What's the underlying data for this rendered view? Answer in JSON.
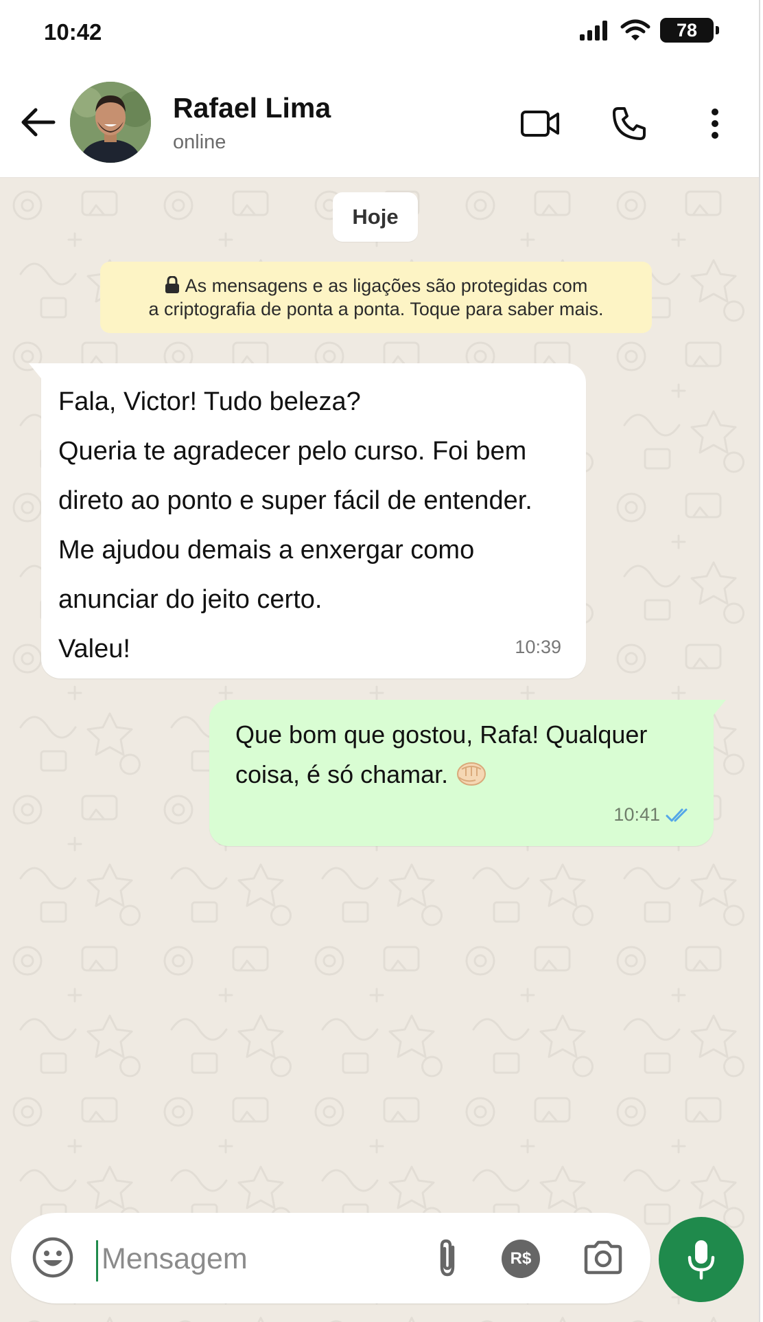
{
  "status_bar": {
    "time": "10:42",
    "battery_level": "78",
    "icons": [
      "signal-icon",
      "wifi-icon",
      "battery-icon"
    ]
  },
  "header": {
    "contact_name": "Rafael Lima",
    "contact_status": "online",
    "icons": [
      "back-arrow-icon",
      "video-call-icon",
      "phone-call-icon",
      "more-options-icon"
    ]
  },
  "chat": {
    "date_separator": "Hoje",
    "encryption_notice": {
      "line1": "As mensagens e as ligações são protegidas com",
      "line2": "a criptografia de ponta a ponta. Toque para saber mais."
    },
    "messages": [
      {
        "direction": "incoming",
        "lines": [
          "Fala, Victor! Tudo beleza?",
          "Queria te agradecer pelo curso. Foi bem",
          "direto ao ponto e super fácil de entender.",
          "Me ajudou demais a enxergar como",
          "anunciar do jeito certo.",
          "Valeu!"
        ],
        "time": "10:39"
      },
      {
        "direction": "outgoing",
        "lines": [
          "Que bom que gostou, Rafa! Qualquer",
          "coisa, é só chamar."
        ],
        "emoji": "fist-bump-emoji",
        "time": "10:41",
        "status_icon": "double-check-read-icon"
      }
    ]
  },
  "composer": {
    "placeholder": "Mensagem",
    "value": "",
    "icons": [
      "emoji-icon",
      "attach-icon",
      "payment-icon",
      "camera-icon",
      "mic-icon"
    ],
    "payment_label": "R$"
  },
  "colors": {
    "accent_green": "#1f8a4c",
    "outgoing_bubble": "#d9fdd3",
    "chat_background": "#efeae2",
    "notice_background": "#fdf4c5",
    "read_check": "#53a6e8"
  }
}
